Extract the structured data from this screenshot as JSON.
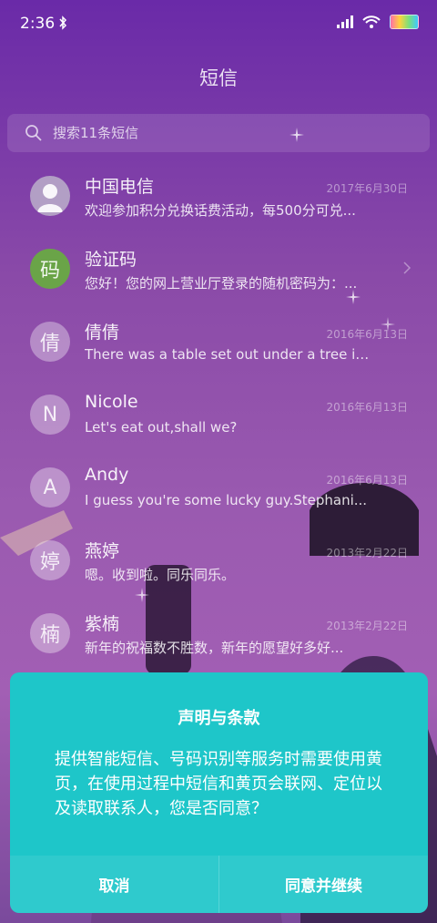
{
  "status_bar": {
    "time": "2:36"
  },
  "page_title": "短信",
  "search": {
    "placeholder": "搜索11条短信"
  },
  "conversations": [
    {
      "name": "中国电信",
      "date": "2017年6月30日",
      "preview": "欢迎参加积分兑换话费活动，每500分可兑...",
      "avatar_char": "",
      "avatar_type": "person"
    },
    {
      "name": "验证码",
      "date": "",
      "preview": "您好！您的网上营业厅登录的随机密码为：...",
      "avatar_char": "码",
      "avatar_type": "green"
    },
    {
      "name": "倩倩",
      "date": "2016年6月13日",
      "preview": "There was a table set out under a tree in...",
      "avatar_char": "倩",
      "avatar_type": "default"
    },
    {
      "name": "Nicole",
      "date": "2016年6月13日",
      "preview": "Let's eat out,shall we?",
      "avatar_char": "N",
      "avatar_type": "default"
    },
    {
      "name": "Andy",
      "date": "2016年6月13日",
      "preview": "I guess you're some lucky guy.Stephani...",
      "avatar_char": "A",
      "avatar_type": "default"
    },
    {
      "name": "燕婷",
      "date": "2013年2月22日",
      "preview": "嗯。收到啦。同乐同乐。",
      "avatar_char": "婷",
      "avatar_type": "default"
    },
    {
      "name": "紫楠",
      "date": "2013年2月22日",
      "preview": "新年的祝福数不胜数，新年的愿望好多好...",
      "avatar_char": "楠",
      "avatar_type": "default"
    }
  ],
  "dialog": {
    "title": "声明与条款",
    "body": "提供智能短信、号码识别等服务时需要使用黄页，在使用过程中短信和黄页会联网、定位以及读取联系人，您是否同意？",
    "cancel_label": "取消",
    "confirm_label": "同意并继续"
  },
  "colors": {
    "dialog_bg": "#1ec6c9",
    "accent_green": "#6aa448"
  },
  "icons": {
    "search": "search-icon",
    "bluetooth": "bluetooth-icon",
    "signal": "signal-icon",
    "wifi": "wifi-icon",
    "battery": "battery-icon",
    "chevron": "chevron-right-icon"
  }
}
